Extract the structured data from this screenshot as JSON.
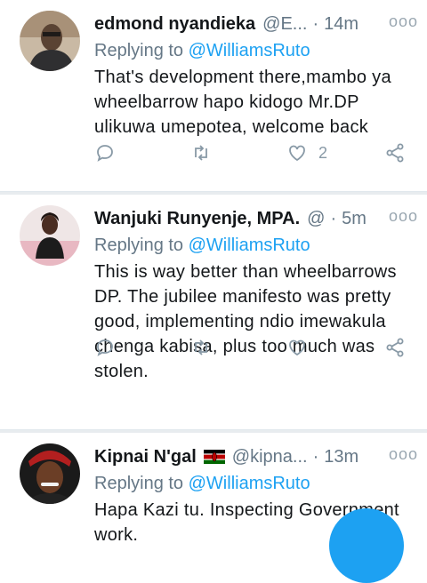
{
  "tweets": [
    {
      "name": "edmond nyandieka",
      "handle": "@E...",
      "time": "14m",
      "more": "ooo",
      "replying_prefix": "Replying to ",
      "replying_to": "@WilliamsRuto",
      "text": "That's development there,mambo ya wheelbarrow hapo kidogo Mr.DP ulikuwa umepotea, welcome back",
      "likes": "2"
    },
    {
      "name": "Wanjuki Runyenje, MPA.",
      "handle": "@",
      "time": "5m",
      "more": "ooo",
      "replying_prefix": "Replying to ",
      "replying_to": "@WilliamsRuto",
      "text": "This is way better than wheelbarrows DP. The jubilee manifesto was pretty good, implementing ndio imewakula chenga kabisa, plus too much was stolen.",
      "likes": ""
    },
    {
      "name": "Kipnai N'gal",
      "handle": "@kipna...",
      "time": "13m",
      "more": "ooo",
      "replying_prefix": "Replying to ",
      "replying_to": "@WilliamsRuto",
      "text": "Hapa Kazi tu. Inspecting Government work.",
      "flag": "kenya-flag-icon"
    }
  ],
  "colors": {
    "accent": "#1da1f2",
    "muted": "#657786",
    "icon": "#8899a6"
  },
  "icons": [
    "reply-icon",
    "retweet-icon",
    "like-icon",
    "share-icon",
    "more-icon",
    "compose-fab"
  ]
}
